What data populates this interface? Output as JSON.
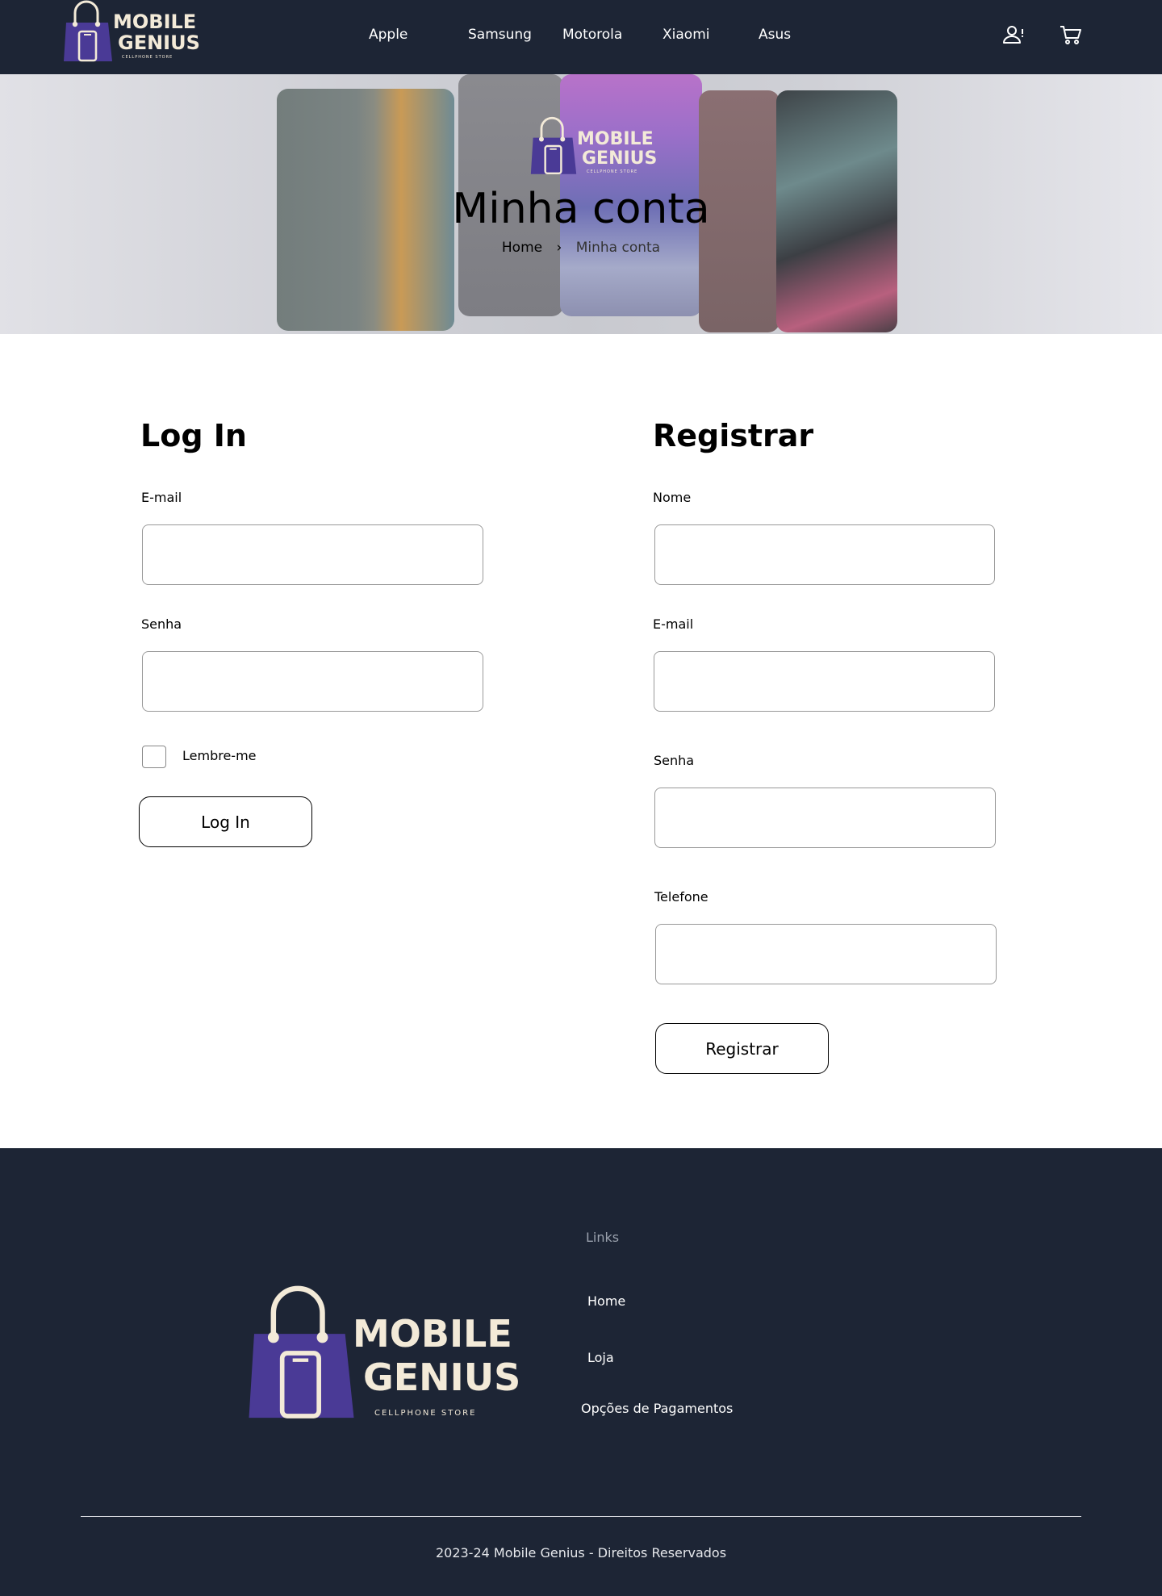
{
  "brand": {
    "name_line1": "MOBILE",
    "name_line2": "GENIUS",
    "tagline": "CELLPHONE STORE",
    "primary_color": "#4a3a96",
    "cream_color": "#f3ead8",
    "dark_color": "#1d2535"
  },
  "nav": {
    "items": [
      "Apple",
      "Samsung",
      "Motorola",
      "Xiaomi",
      "Asus"
    ]
  },
  "header_icons": {
    "account": "user-icon",
    "cart": "cart-icon"
  },
  "hero": {
    "title": "Minha conta",
    "breadcrumb_home": "Home",
    "breadcrumb_separator": "›",
    "breadcrumb_current": "Minha conta"
  },
  "login": {
    "title": "Log In",
    "email_label": "E-mail",
    "email_value": "",
    "password_label": "Senha",
    "password_value": "",
    "remember_label": "Lembre-me",
    "remember_checked": false,
    "submit_label": "Log In"
  },
  "register": {
    "title": "Registrar",
    "name_label": "Nome",
    "name_value": "",
    "email_label": "E-mail",
    "email_value": "",
    "password_label": "Senha",
    "password_value": "",
    "phone_label": "Telefone",
    "phone_value": "",
    "submit_label": "Registrar"
  },
  "footer": {
    "links_heading": "Links",
    "links": [
      "Home",
      "Loja",
      "Opções de Pagamentos"
    ],
    "copyright": "2023-24 Mobile Genius - Direitos Reservados"
  }
}
